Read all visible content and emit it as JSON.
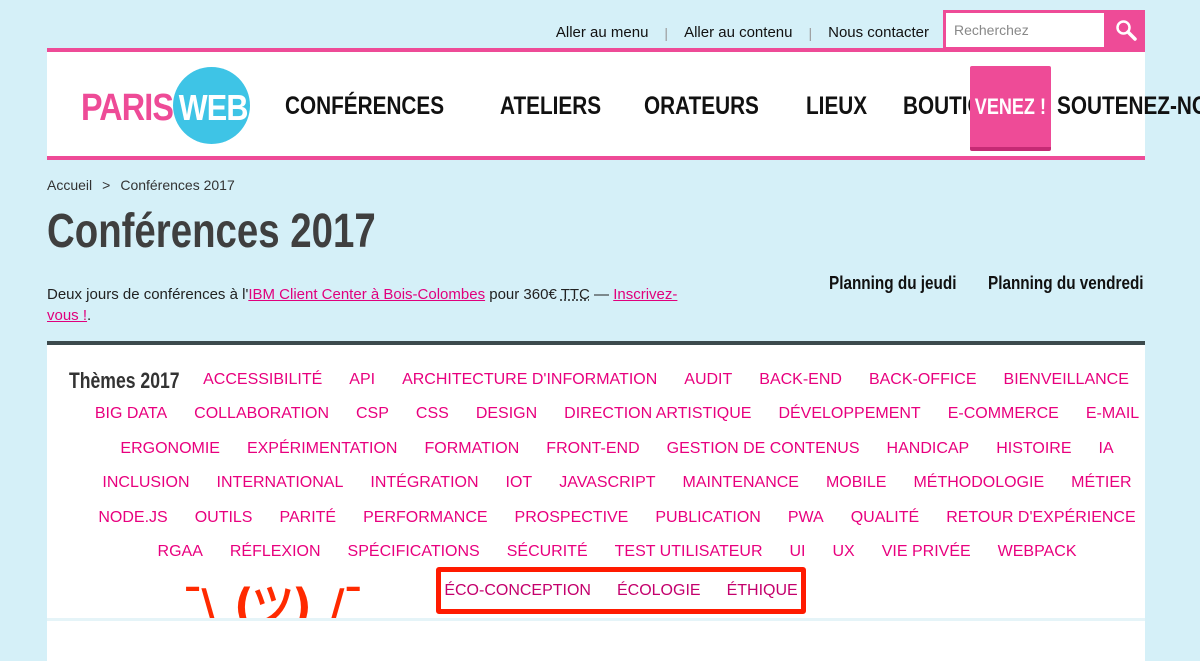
{
  "utility_nav": {
    "items": [
      "Aller au menu",
      "Aller au contenu",
      "Nous contacter"
    ],
    "separator": "|"
  },
  "search": {
    "placeholder": "Recherchez",
    "icon": "search-icon"
  },
  "logo": {
    "part1": "PARIS",
    "part2": "WEB"
  },
  "main_nav": {
    "items": [
      "CONFÉRENCES",
      "ATELIERS",
      "ORATEURS",
      "LIEUX",
      "BOUTIQUE",
      "SOUTENEZ-NOUS"
    ],
    "cta": "VENEZ !"
  },
  "breadcrumb": {
    "home": "Accueil",
    "separator": ">",
    "current": "Conférences 2017"
  },
  "page": {
    "title": "Conférences 2017",
    "intro_prefix": "Deux jours de conférences à l'",
    "venue_link": "IBM Client Center à Bois-Colombes",
    "intro_middle": " pour 360€ ",
    "abbr": "TTC",
    "intro_dash": " — ",
    "signup_link": "Inscrivez-vous !",
    "intro_suffix": "."
  },
  "planning": {
    "thursday": "Planning du jeudi",
    "friday": "Planning du vendredi"
  },
  "themes": {
    "title": "Thèmes 2017",
    "rows": [
      [
        "ACCESSIBILITÉ",
        "API",
        "ARCHITECTURE D'INFORMATION",
        "AUDIT",
        "BACK-END",
        "BACK-OFFICE",
        "BIENVEILLANCE"
      ],
      [
        "BIG DATA",
        "COLLABORATION",
        "CSP",
        "CSS",
        "DESIGN",
        "DIRECTION ARTISTIQUE",
        "DÉVELOPPEMENT",
        "E-COMMERCE",
        "E-MAIL"
      ],
      [
        "ERGONOMIE",
        "EXPÉRIMENTATION",
        "FORMATION",
        "FRONT-END",
        "GESTION DE CONTENUS",
        "HANDICAP",
        "HISTOIRE",
        "IA"
      ],
      [
        "INCLUSION",
        "INTERNATIONAL",
        "INTÉGRATION",
        "IOT",
        "JAVASCRIPT",
        "MAINTENANCE",
        "MOBILE",
        "MÉTHODOLOGIE",
        "MÉTIER"
      ],
      [
        "NODE.JS",
        "OUTILS",
        "PARITÉ",
        "PERFORMANCE",
        "PROSPECTIVE",
        "PUBLICATION",
        "PWA",
        "QUALITÉ",
        "RETOUR D'EXPÉRIENCE"
      ],
      [
        "RGAA",
        "RÉFLEXION",
        "SPÉCIFICATIONS",
        "SÉCURITÉ",
        "TEST UTILISATEUR",
        "UI",
        "UX",
        "VIE PRIVÉE",
        "WEBPACK"
      ]
    ],
    "highlighted": [
      "ÉCO-CONCEPTION",
      "ÉCOLOGIE",
      "ÉTHIQUE"
    ]
  },
  "annotation": {
    "shrug": "¯\\_(ツ)_/¯"
  },
  "colors": {
    "pink": "#ee4b97",
    "blue": "#3ec4e6",
    "background": "#d5f0f8",
    "annotation_red": "#ff1a00"
  }
}
